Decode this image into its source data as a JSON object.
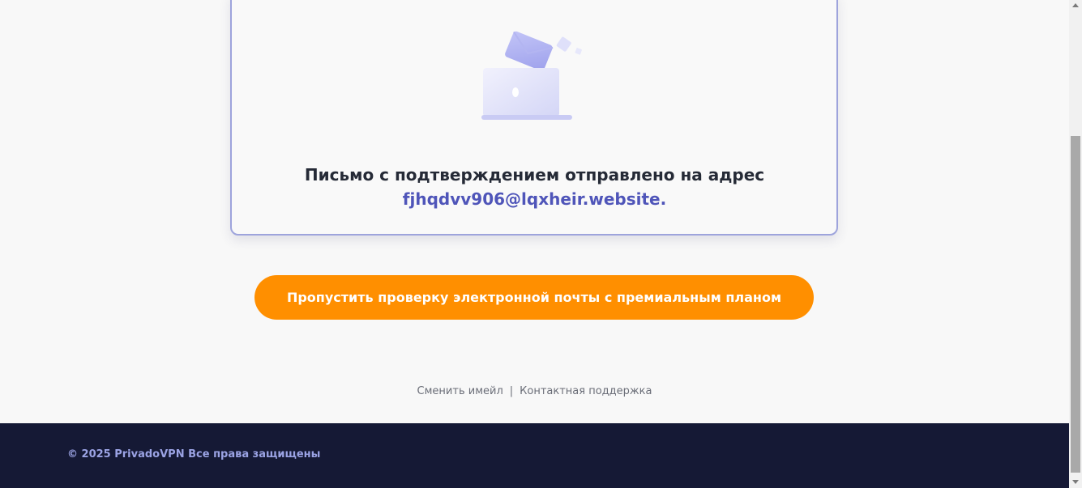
{
  "card": {
    "icon": "email-sent-laptop-icon",
    "message": "Письмо с подтверждением отправлено на адрес",
    "email": "fjhqdvv906@lqxheir.website."
  },
  "skip_button": {
    "label": "Пропустить проверку электронной почты с премиальным планом",
    "color": "#ff8f00"
  },
  "links": {
    "change_email": "Сменить имейл",
    "separator": "|",
    "support": "Контактная поддержка"
  },
  "footer": {
    "copyright": "© 2025 PrivadoVPN Все права защищены",
    "background": "#151935"
  },
  "colors": {
    "accent": "#4f55b9",
    "card_border": "#9ea4dc"
  }
}
